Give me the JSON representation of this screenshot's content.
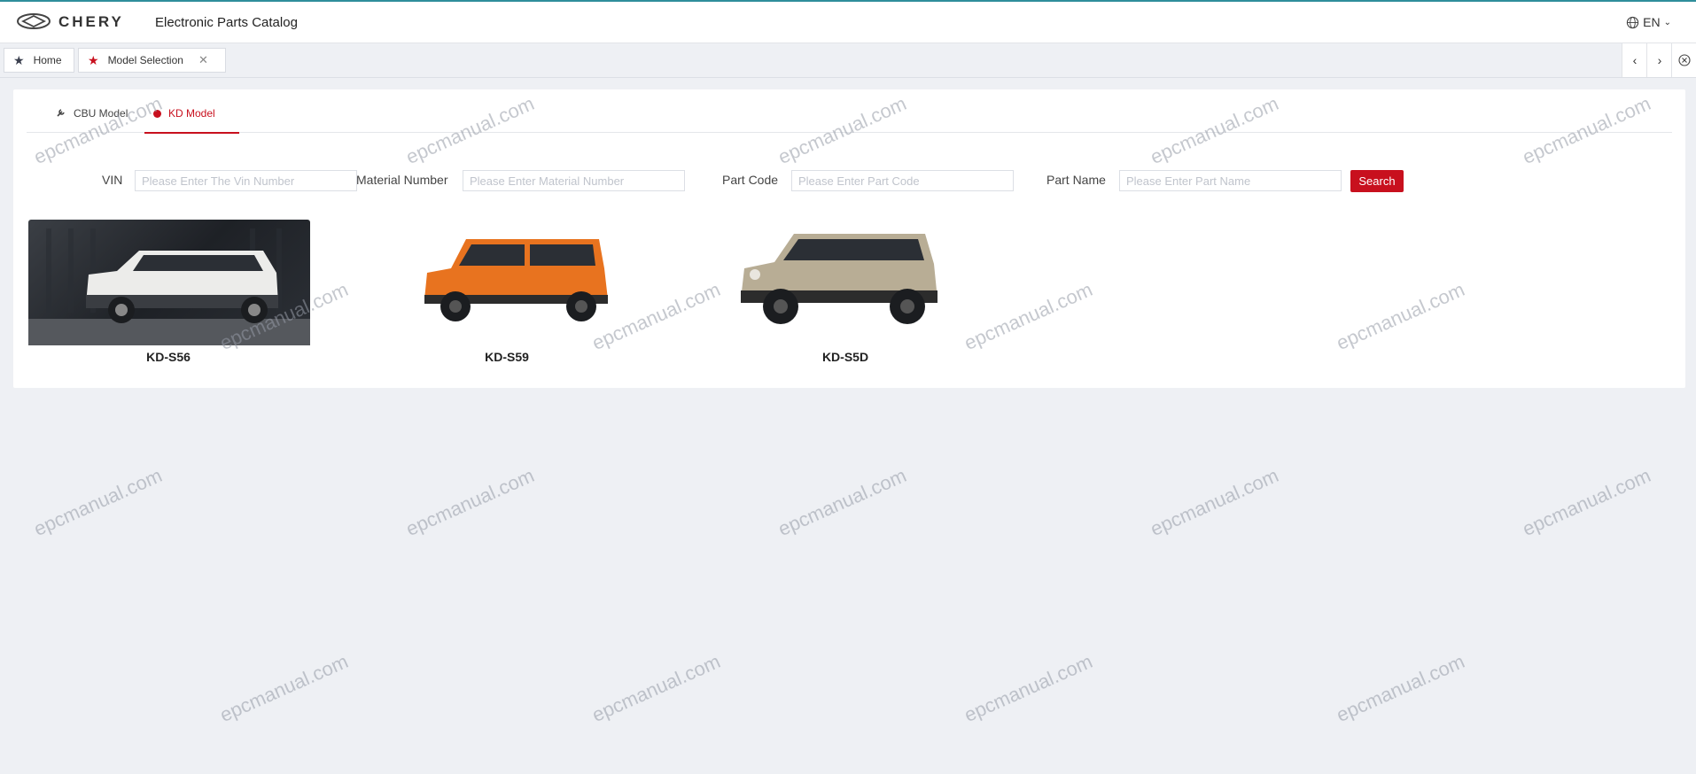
{
  "header": {
    "brand": "CHERY",
    "app_title": "Electronic Parts Catalog",
    "language": "EN"
  },
  "tabs": [
    {
      "label": "Home"
    },
    {
      "label": "Model Selection"
    }
  ],
  "subtabs": {
    "cbu": "CBU Model",
    "kd": "KD Model"
  },
  "filters": {
    "vin_label": "VIN",
    "vin_placeholder": "Please Enter The Vin Number",
    "material_label": "Material Number",
    "material_placeholder": "Please Enter Material Number",
    "partcode_label": "Part Code",
    "partcode_placeholder": "Please Enter Part Code",
    "partname_label": "Part Name",
    "partname_placeholder": "Please Enter Part Name",
    "search_label": "Search"
  },
  "models": [
    {
      "name": "KD-S56",
      "color": "#e8e8e6"
    },
    {
      "name": "KD-S59",
      "color": "#e8731f"
    },
    {
      "name": "KD-S5D",
      "color": "#b8ad95"
    }
  ],
  "watermark": "epcmanual.com",
  "colors": {
    "accent": "#c8101e",
    "teal_line": "#2f8e9b"
  }
}
